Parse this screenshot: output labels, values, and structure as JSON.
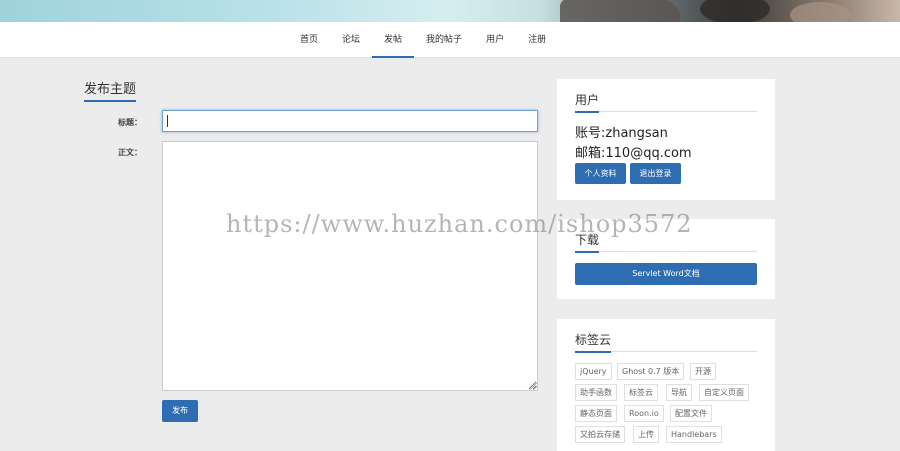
{
  "nav": {
    "items": [
      {
        "label": "首页"
      },
      {
        "label": "论坛"
      },
      {
        "label": "发帖"
      },
      {
        "label": "我的帖子"
      },
      {
        "label": "用户"
      },
      {
        "label": "注册"
      }
    ],
    "active_index": 2
  },
  "post_form": {
    "heading": "发布主题",
    "title_label": "标题：",
    "title_value": "",
    "content_label": "正文：",
    "content_value": "",
    "submit_label": "发布"
  },
  "user_panel": {
    "heading": "用户",
    "account_line": "账号:zhangsan",
    "email_line": "邮箱:110@qq.com",
    "profile_button": "个人资料",
    "logout_button": "退出登录"
  },
  "download_panel": {
    "heading": "下载",
    "button_label": "Servlet Word文档"
  },
  "tag_panel": {
    "heading": "标签云",
    "tags": [
      "jQuery",
      "Ghost 0.7 版本",
      "开源",
      "助手函数",
      "标签云",
      "导航",
      "自定义页面",
      "静态页面",
      "Roon.io",
      "配置文件",
      "又拍云存储",
      "上传",
      "Handlebars"
    ]
  },
  "watermark": "https://www.huzhan.com/ishop3572",
  "colors": {
    "accent": "#2f6db3",
    "background": "#ececec"
  }
}
